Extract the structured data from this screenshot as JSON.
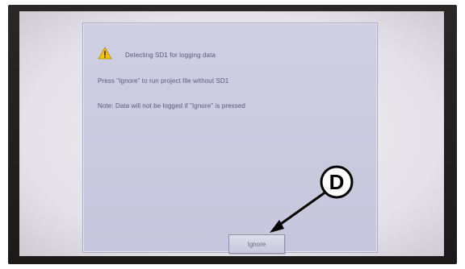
{
  "dialog": {
    "title": "Detecting SD1 for logging data",
    "line1": "Press \"Ignore\" to run project file without SD1",
    "line2": "Note: Data will not be logged if \"Ignore\" is pressed",
    "ignore_label": "Ignore",
    "icon": "warning-icon"
  },
  "callout": {
    "letter": "D",
    "icon": "arrow-icon"
  },
  "colors": {
    "dialog_bg": "#c8c8dd",
    "warning_yellow": "#f2c200",
    "text": "#5a5a78"
  }
}
